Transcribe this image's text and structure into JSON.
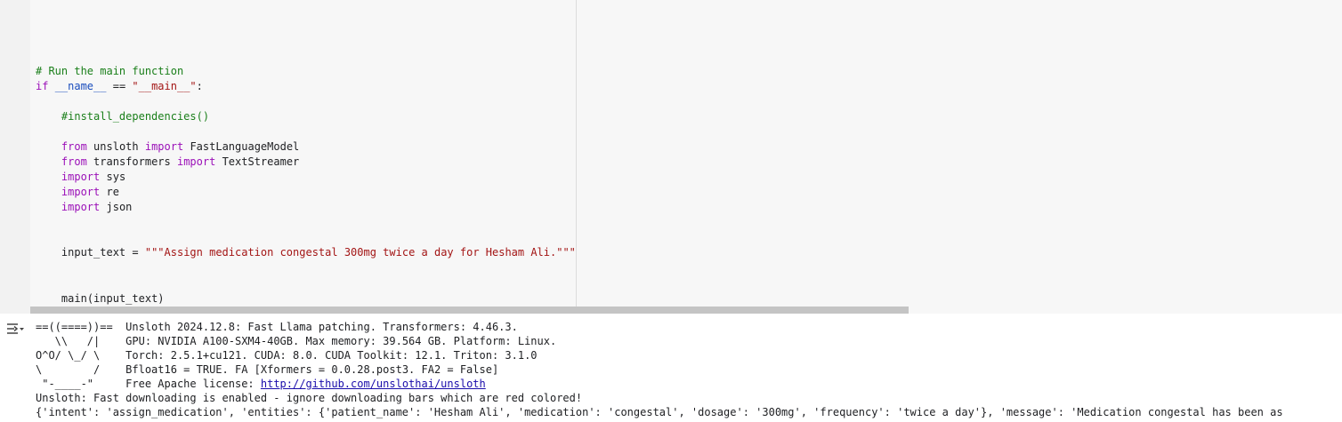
{
  "code": {
    "comment": "# Run the main function",
    "if_line": {
      "kw": "if",
      "dunder": "__name__",
      "op": "==",
      "str": "\"__main__\"",
      "colon": ":"
    },
    "install_comment": "#install_dependencies()",
    "imports": [
      {
        "kw1": "from",
        "mod": "unsloth",
        "kw2": "import",
        "name": "FastLanguageModel"
      },
      {
        "kw1": "from",
        "mod": "transformers",
        "kw2": "import",
        "name": "TextStreamer"
      }
    ],
    "simple_imports": [
      {
        "kw": "import",
        "mod": "sys"
      },
      {
        "kw": "import",
        "mod": "re"
      },
      {
        "kw": "import",
        "mod": "json"
      }
    ],
    "input_assign": {
      "var": "input_text",
      "op": "=",
      "str": "\"\"\"Assign medication congestal 300mg twice a day for Hesham Ali.\"\"\""
    },
    "main_call": {
      "fn": "main",
      "open": "(",
      "arg": "input_text",
      "close": ")"
    }
  },
  "output": {
    "toggle_icon": "output-collapse-icon",
    "banner": [
      {
        "art": "==((====))==",
        "text": "Unsloth 2024.12.8: Fast Llama patching. Transformers: 4.46.3."
      },
      {
        "art": "   \\\\   /|",
        "text": "GPU: NVIDIA A100-SXM4-40GB. Max memory: 39.564 GB. Platform: Linux."
      },
      {
        "art": "O^O/ \\_/ \\",
        "text": "Torch: 2.5.1+cu121. CUDA: 8.0. CUDA Toolkit: 12.1. Triton: 3.1.0"
      },
      {
        "art": "\\        /",
        "text": "Bfloat16 = TRUE. FA [Xformers = 0.0.28.post3. FA2 = False]"
      },
      {
        "art": " \"-____-\"",
        "text": "Free Apache license: ",
        "link": "http://github.com/unslothai/unsloth"
      }
    ],
    "fast_download": "Unsloth: Fast downloading is enabled - ignore downloading bars which are red colored!",
    "result": "{'intent': 'assign_medication', 'entities': {'patient_name': 'Hesham Ali', 'medication': 'congestal', 'dosage': '300mg', 'frequency': 'twice a day'}, 'message': 'Medication congestal has been as"
  }
}
